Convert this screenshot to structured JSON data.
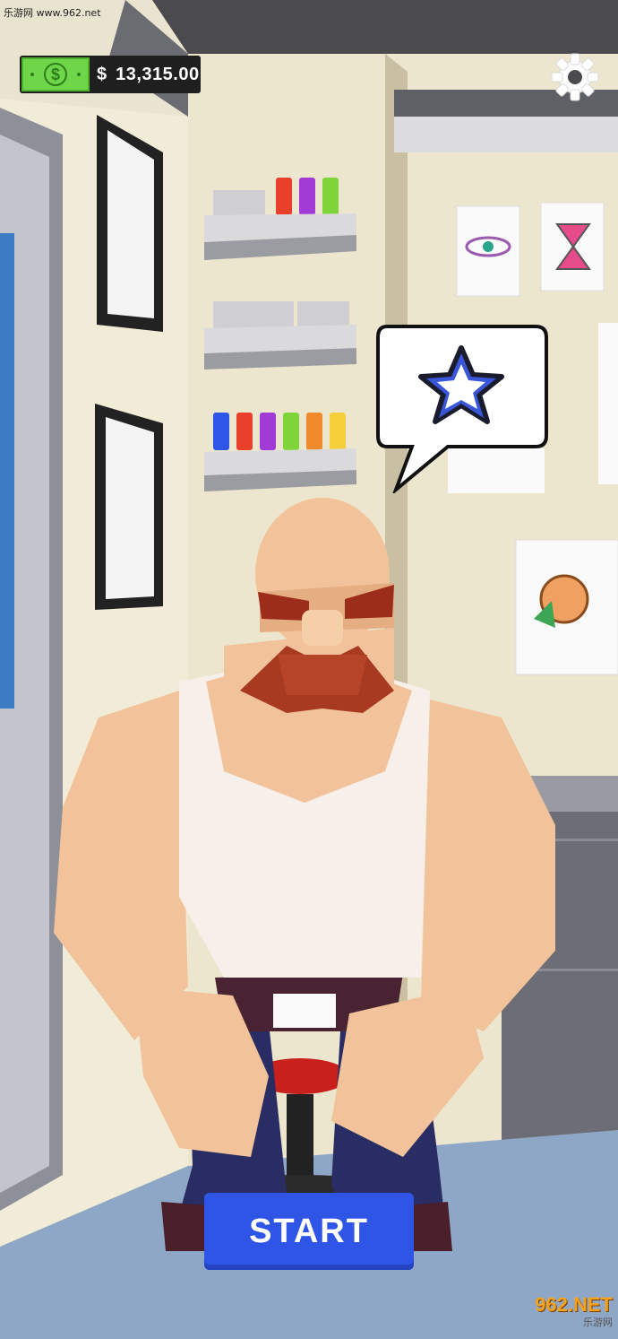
{
  "watermark": {
    "site": "乐游网 www.962.net",
    "logo_main": "962.NET",
    "logo_sub": "乐游网"
  },
  "hud": {
    "currency_symbol": "$",
    "balance": "13,315.00",
    "bill_symbol": "$"
  },
  "bubble": {
    "icon": "star-icon"
  },
  "start_button": {
    "label": "START"
  },
  "colors": {
    "wall": "#e9e4cf",
    "floor": "#8fa7c7",
    "button": "#2f55e6",
    "money_green": "#6fd64a",
    "beard": "#a83a22",
    "skin": "#f2c39a",
    "shirt": "#f7f0ea"
  }
}
